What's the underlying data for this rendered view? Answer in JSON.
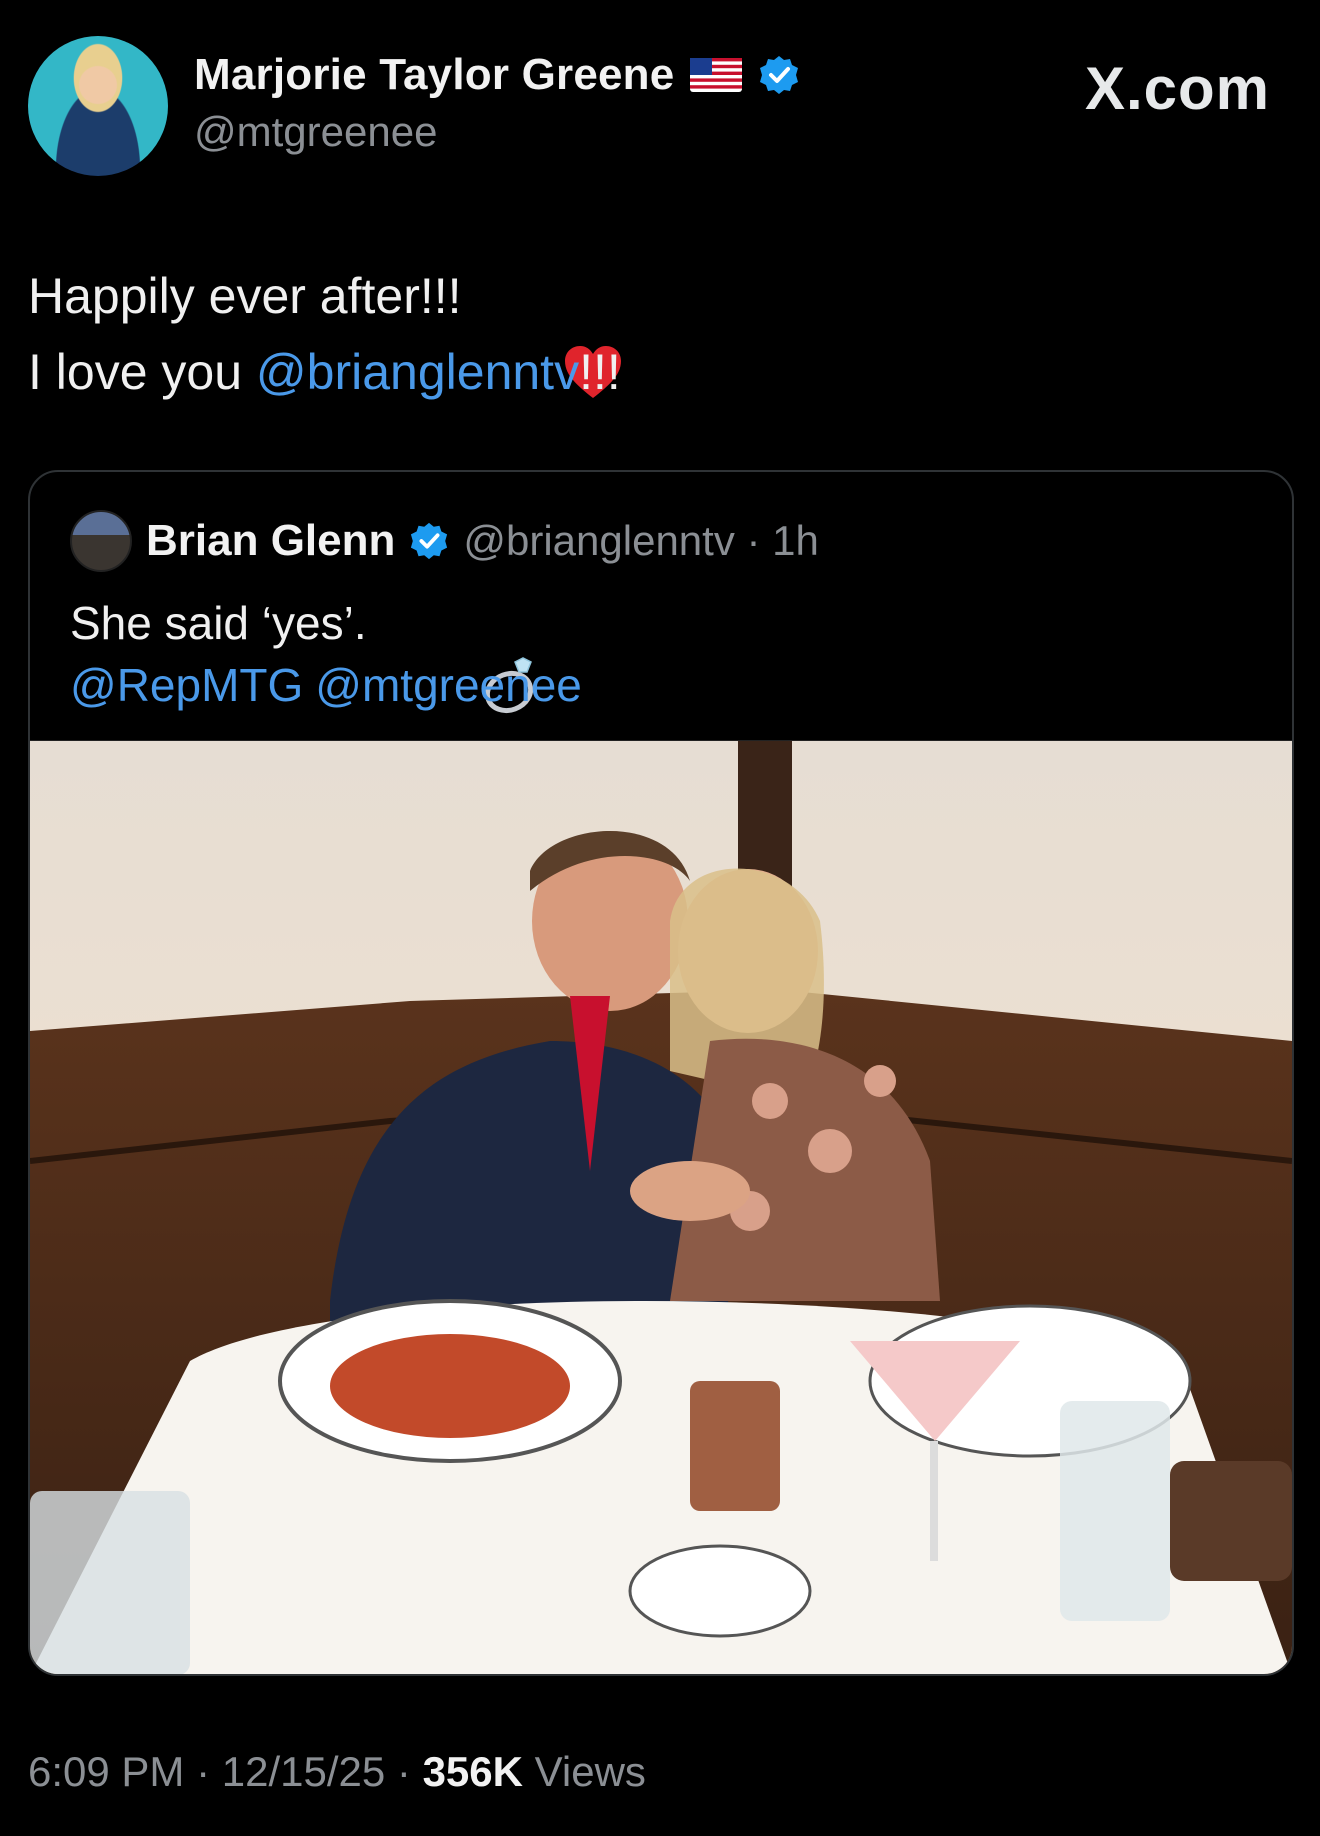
{
  "post": {
    "author_name": "Marjorie Taylor Greene",
    "author_handle": "@mtgreenee",
    "brand": "X.com",
    "text_line1": "Happily ever after!!!",
    "text_line2_prefix": "I love you ",
    "text_line2_mention": "@brianglenntv",
    "text_line2_suffix": "!!!",
    "time": "6:09 PM",
    "date": "12/15/25",
    "views_count": "356K",
    "views_label": "Views"
  },
  "quoted_post": {
    "author_name": "Brian Glenn",
    "author_handle": "@brianglenntv",
    "age": "1h",
    "text": "She said ‘yes’.",
    "mention_1": "@RepMTG",
    "mention_2": "@mtgreenee"
  },
  "icons": {
    "flag": "us-flag-icon",
    "verified": "verified-badge-icon",
    "heart": "red-heart-icon",
    "ring": "ring-icon"
  },
  "colors": {
    "background": "#000000",
    "mention": "#4a99e9",
    "verified": "#1d9bf0",
    "secondary_text": "#8b8f94"
  }
}
